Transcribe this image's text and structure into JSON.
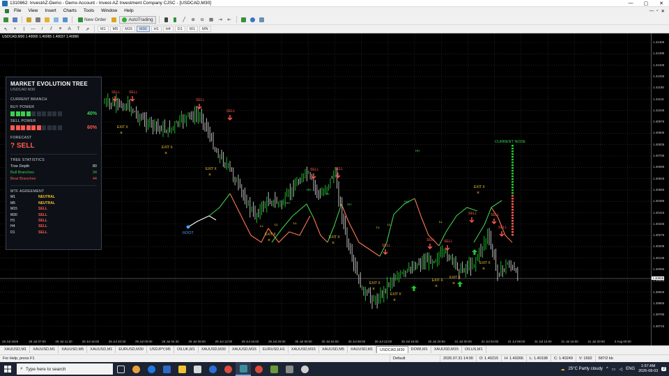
{
  "window": {
    "title": "1310862: InvestAZ-Demo - Demo Account - Invest-AZ Investment Company CJSC - [USDCAD,M30]",
    "controls": [
      "—",
      "▢",
      "✕"
    ]
  },
  "menu": {
    "items": [
      "File",
      "View",
      "Insert",
      "Charts",
      "Tools",
      "Window",
      "Help"
    ],
    "mdi_controls": [
      "—",
      "▫",
      "✕"
    ]
  },
  "toolbar": {
    "new_order": "New Order",
    "autotrading": "AutoTrading",
    "timeframes": [
      "M1",
      "M5",
      "M15",
      "M30",
      "H1",
      "H4",
      "D1",
      "W1",
      "MN"
    ],
    "active_timeframe": "M30"
  },
  "chart": {
    "header": "USDCAD,M30  1.40065 1.40065 1.40037 1.40066",
    "price_labels": [
      "1.41465",
      "1.41395",
      "1.41325",
      "1.41255",
      "1.41185",
      "1.41115",
      "1.41045",
      "1.40975",
      "1.40905",
      "1.40835",
      "1.40765",
      "1.40695",
      "1.40625",
      "1.40555",
      "1.40485",
      "1.40415",
      "1.40345",
      "1.40275",
      "1.40205",
      "1.40135",
      "1.40065",
      "1.39995",
      "1.39925",
      "1.39855",
      "1.39785",
      "1.39715"
    ],
    "current_price": "1.40066",
    "time_labels": [
      "29 Jul 2026",
      "29 Jul 07:00",
      "29 Jul 11:30",
      "29 Jul 16:00",
      "29 Jul 20:30",
      "29 Jul 00:00",
      "29 Jul 04:30",
      "29 Jul 09:00",
      "29 Jul 12:00",
      "29 Jul 16:00",
      "29 Jul 20:00",
      "30 Jul 00:00",
      "30 Jul 04:00",
      "30 Jul 08:00",
      "30 Jul 12:00",
      "30 Jul 16:00",
      "30 Jul 20:00",
      "31 Jul 00:00",
      "31 Jul 04:00",
      "31 Jul 08:00",
      "31 Jul 12:00",
      "31 Jul 16:00",
      "31 Jul 20:00",
      "3 Aug 00:00"
    ],
    "labels": {
      "root": "ROOT",
      "current_node": "CURRENT NODE",
      "sell": "SELL",
      "exit": "EXIT X",
      "hh": "HH",
      "ll": "LL"
    }
  },
  "panel": {
    "title": "MARKET EVOLUTION TREE",
    "subtitle": "USDCAD M30",
    "current_branch": "CURRENT BRANCH",
    "buy_power_label": "BUY POWER",
    "buy_power_value": "40%",
    "buy_power_filled": 4,
    "sell_power_label": "SELL POWER",
    "sell_power_value": "60%",
    "sell_power_filled": 6,
    "power_cells": 10,
    "forecast_label": "FORECAST",
    "forecast_value": "? SELL",
    "tree_stats_label": "TREE STATISTICS",
    "stats": [
      {
        "label": "Tree Depth",
        "value": "80",
        "color": "#e6e6e6"
      },
      {
        "label": "Bull Branches",
        "value": "34",
        "color": "#3ccf4e"
      },
      {
        "label": "Bear Branches",
        "value": "44",
        "color": "#ff5a4e"
      }
    ],
    "mtf_label": "MTF AGREEMENT",
    "mtf": [
      {
        "tf": "M1",
        "value": "NEUTRAL",
        "color": "#f2c230"
      },
      {
        "tf": "M5",
        "value": "NEUTRAL",
        "color": "#f2c230"
      },
      {
        "tf": "M15",
        "value": "SELL",
        "color": "#ff5a4e"
      },
      {
        "tf": "M30",
        "value": "SELL",
        "color": "#ff5a4e"
      },
      {
        "tf": "H1",
        "value": "SELL",
        "color": "#ff5a4e"
      },
      {
        "tf": "H4",
        "value": "SELL",
        "color": "#ff5a4e"
      },
      {
        "tf": "D1",
        "value": "SELL",
        "color": "#ff5a4e"
      }
    ]
  },
  "symbol_tabs": [
    "XAUUSD,M1",
    "XAUUSD,M1",
    "XAUUSD,M5",
    "XAUUSD,M1",
    "EURUSD,M30",
    "USDJPY,M5",
    "OILUK,M1",
    "XAUUSD,M30",
    "XAUUSD,M15",
    "EURUSD,H1",
    "XAUUSD,M15",
    "XAUUSD,M5",
    "XAUUSD,M1",
    "USDCAD,M30",
    "DOWI,M1",
    "XAUUSD,M15",
    "OILUS,M1"
  ],
  "active_symbol_tab": "USDCAD,M30",
  "status": {
    "help": "For Help, press F1",
    "profile": "Default",
    "datetime": "2026.07.31 14:00",
    "open": "O: 1.40215",
    "high": "H: 1.40266",
    "low": "L: 1.40198",
    "close": "C: 1.40249",
    "volume": "V: 1692",
    "traffic": "587/2 kb"
  },
  "taskbar": {
    "search_placeholder": "Type here to search",
    "weather": "25°C  Partly cloudy",
    "lang": "ENG",
    "time": "1:57 AM",
    "date": "2026-08-03",
    "notification_count": "2"
  },
  "colors": {
    "bull": "#22c832",
    "bear": "#ff5a4e",
    "bull_tree": "#3ccf4e",
    "bear_tree": "#ff7a55",
    "exit": "#f2c230",
    "root": "#4aa3ff"
  }
}
